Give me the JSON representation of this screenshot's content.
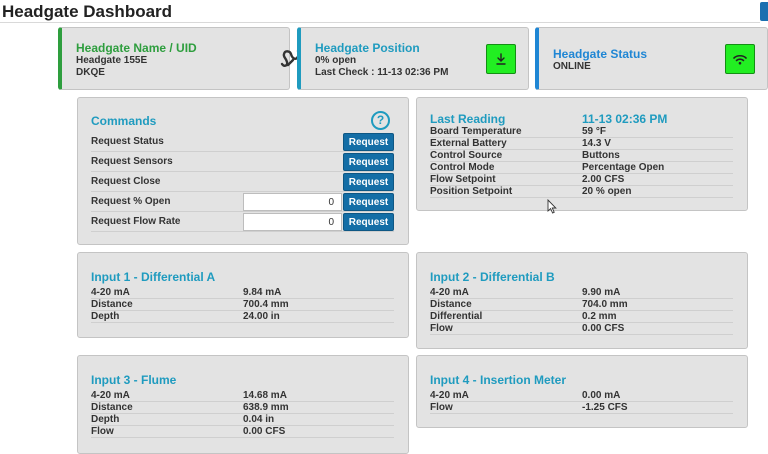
{
  "page": {
    "title": "Headgate Dashboard"
  },
  "status_cards": {
    "name": {
      "title": "Headgate Name / UID",
      "line1": "Headgate 155E",
      "line2": "DKQE",
      "icon": "squiggle-icon"
    },
    "position": {
      "title": "Headgate Position",
      "line1": "0% open",
      "line2": "Last Check : 11-13 02:36 PM",
      "button_icon": "download-icon",
      "button_color": "#22ee22"
    },
    "status": {
      "title": "Headgate Status",
      "line1": "ONLINE",
      "button_icon": "wifi-icon",
      "button_color": "#22ee22"
    }
  },
  "colors": {
    "accent_teal": "#1f9bbf",
    "accent_green": "#2e9e3e",
    "accent_blue": "#1f86d4",
    "button_blue": "#146ea6",
    "indicator_green": "#22ee22"
  },
  "commands": {
    "title": "Commands",
    "help_icon": "question-icon",
    "button_label": "Request",
    "rows": [
      {
        "label": "Request Status"
      },
      {
        "label": "Request Sensors"
      },
      {
        "label": "Request Close"
      },
      {
        "label": "Request % Open",
        "input_value": "0"
      },
      {
        "label": "Request Flow Rate",
        "input_value": "0"
      }
    ]
  },
  "last_reading": {
    "title": "Last Reading",
    "timestamp": "11-13 02:36 PM",
    "rows": [
      {
        "k": "Board Temperature",
        "v": "59 °F"
      },
      {
        "k": "External Battery",
        "v": "14.3 V"
      },
      {
        "k": "Control Source",
        "v": "Buttons"
      },
      {
        "k": "Control Mode",
        "v": "Percentage Open"
      },
      {
        "k": "Flow Setpoint",
        "v": "2.00 CFS"
      },
      {
        "k": "Position Setpoint",
        "v": "20 % open"
      }
    ]
  },
  "input1": {
    "title": "Input 1 - Differential A",
    "rows": [
      {
        "k": "4-20 mA",
        "v": "9.84 mA"
      },
      {
        "k": "Distance",
        "v": "700.4 mm"
      },
      {
        "k": "Depth",
        "v": "24.00 in"
      }
    ]
  },
  "input2": {
    "title": "Input 2 - Differential B",
    "rows": [
      {
        "k": "4-20 mA",
        "v": "9.90 mA"
      },
      {
        "k": "Distance",
        "v": "704.0 mm"
      },
      {
        "k": "Differential",
        "v": "0.2 mm"
      },
      {
        "k": "Flow",
        "v": "0.00 CFS"
      }
    ]
  },
  "input3": {
    "title": "Input 3 - Flume",
    "rows": [
      {
        "k": "4-20 mA",
        "v": "14.68 mA"
      },
      {
        "k": "Distance",
        "v": "638.9 mm"
      },
      {
        "k": "Depth",
        "v": "0.04 in"
      },
      {
        "k": "Flow",
        "v": "0.00 CFS"
      }
    ]
  },
  "input4": {
    "title": "Input 4 - Insertion Meter",
    "rows": [
      {
        "k": "4-20 mA",
        "v": "0.00 mA"
      },
      {
        "k": "Flow",
        "v": "-1.25 CFS"
      }
    ]
  }
}
